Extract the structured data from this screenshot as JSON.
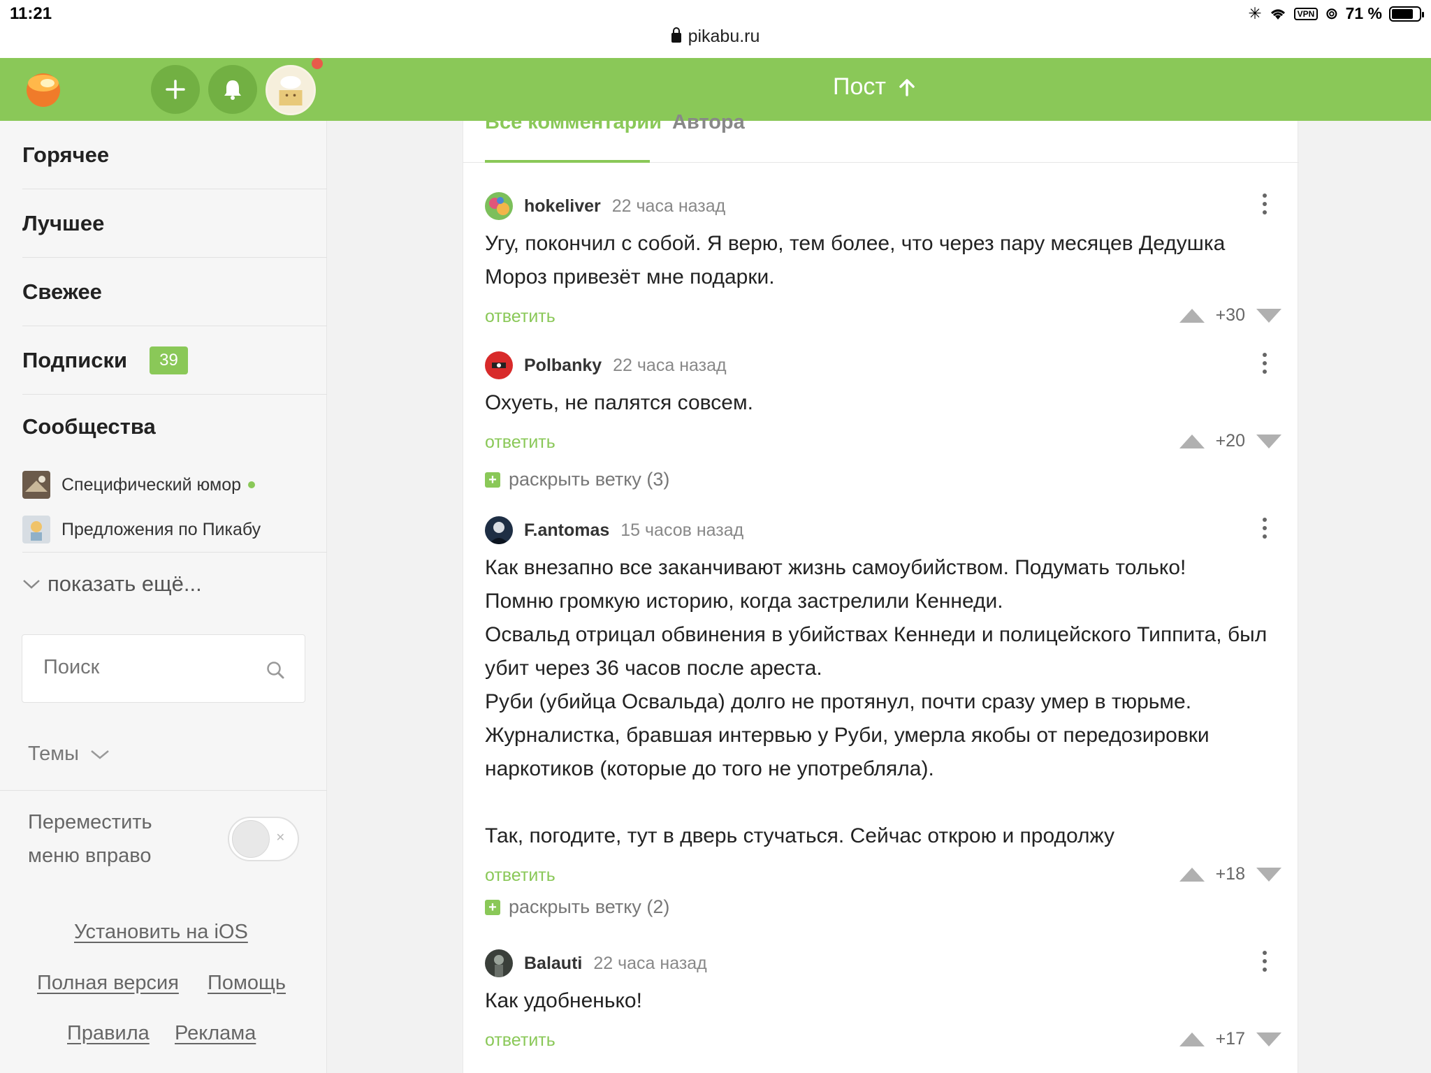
{
  "status": {
    "time": "11:21",
    "vpn": "VPN",
    "battery": "71 %"
  },
  "url": "pikabu.ru",
  "header": {
    "title": "Пост",
    "add_icon": "plus-icon",
    "bell_icon": "bell-icon",
    "accent": "#8ac858"
  },
  "sidebar": {
    "nav": [
      {
        "label": "Горячее"
      },
      {
        "label": "Лучшее"
      },
      {
        "label": "Свежее"
      },
      {
        "label": "Подписки",
        "badge": "39"
      }
    ],
    "communities_title": "Сообщества",
    "communities": [
      {
        "name": "Специфический юмор"
      },
      {
        "name": "Предложения по Пикабу"
      }
    ],
    "show_more": "показать ещё...",
    "search_placeholder": "Поиск",
    "themes": "Темы",
    "move_menu": "Переместить меню вправо",
    "install": "Установить на iOS",
    "full_version": "Полная версия",
    "help": "Помощь",
    "rules": "Правила",
    "ads": "Реклама"
  },
  "tabs": {
    "all": "Все комментарии",
    "author": "Автора"
  },
  "comments": [
    {
      "user": "hokeliver",
      "time": "22 часа назад",
      "text": "Угу, покончил с собой. Я верю, тем более, что через пару месяцев Дедушка Мороз привезёт мне подарки.",
      "reply": "ответить",
      "rating": "+30"
    },
    {
      "user": "Polbanky",
      "time": "22 часа назад",
      "text": "Охуеть, не палятся совсем.",
      "reply": "ответить",
      "rating": "+20",
      "expand": "раскрыть ветку (3)"
    },
    {
      "user": "F.antomas",
      "time": "15 часов назад",
      "text": "Как внезапно все заканчивают жизнь самоубийством. Подумать только!\nПомню громкую историю, когда застрелили Кеннеди.\nОсвальд отрицал обвинения в убийствах Кеннеди и полицейского Типпита, был убит через 36 часов после ареста.\nРуби (убийца Освальда) долго не протянул, почти сразу умер в тюрьме.\nЖурналистка, бравшая интервью у Руби, умерла якобы от передозировки наркотиков (которые до того не употребляла).\n\nТак, погодите, тут в дверь стучаться. Сейчас открою и продолжу",
      "reply": "ответить",
      "rating": "+18",
      "expand": "раскрыть ветку (2)"
    },
    {
      "user": "Balauti",
      "time": "22 часа назад",
      "text": "Как удобненько!",
      "reply": "ответить",
      "rating": "+17"
    }
  ]
}
